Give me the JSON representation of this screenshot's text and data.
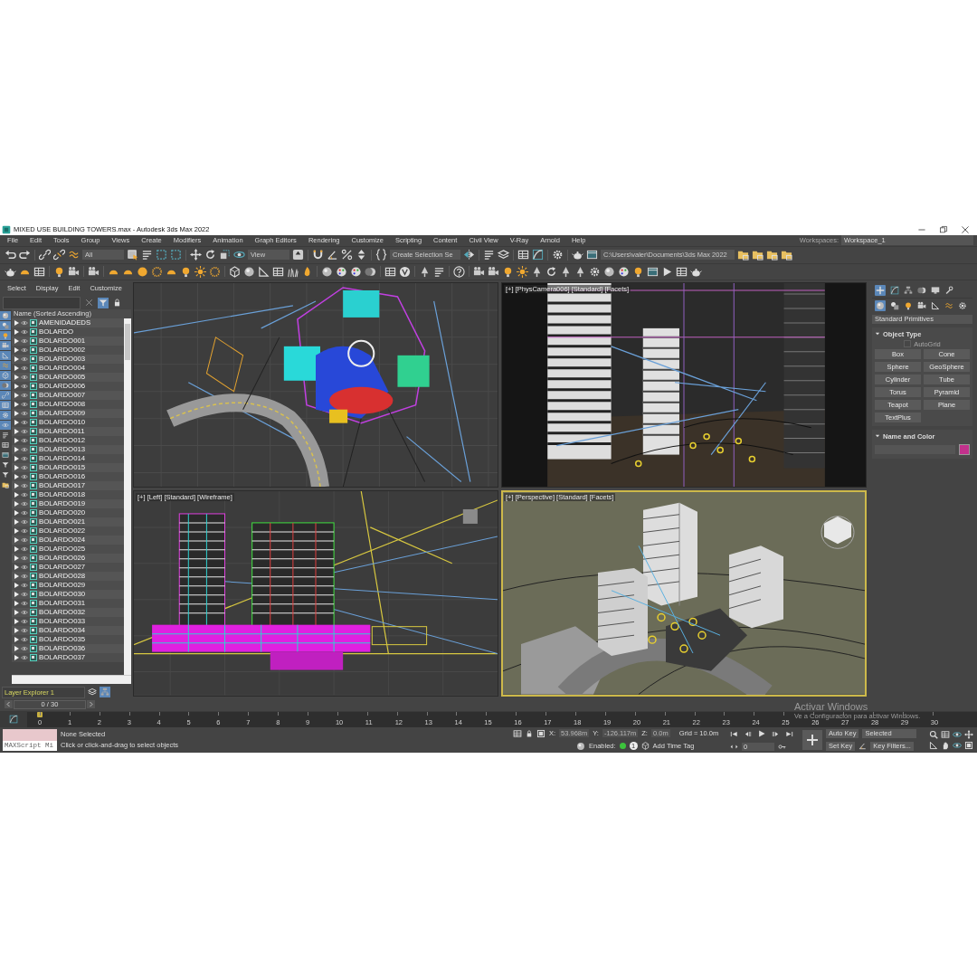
{
  "window": {
    "title": "MIXED USE BUILDING TOWERS.max - Autodesk 3ds Max 2022"
  },
  "menu": [
    "File",
    "Edit",
    "Tools",
    "Group",
    "Views",
    "Create",
    "Modifiers",
    "Animation",
    "Graph Editors",
    "Rendering",
    "Customize",
    "Scripting",
    "Content",
    "Civil View",
    "V-Ray",
    "Arnold",
    "Help"
  ],
  "workspaces": {
    "label": "Workspaces:",
    "value": "Workspace_1"
  },
  "toolbar": {
    "dropdowns": [
      {
        "value": "All"
      },
      {
        "value": "View"
      },
      {
        "value": "Create Selection Se"
      },
      {
        "value": "C:\\Users\\valer\\Documents\\3ds Max 2022"
      }
    ]
  },
  "scene_explorer": {
    "menu": [
      "Select",
      "Display",
      "Edit",
      "Customize"
    ],
    "column": "Name (Sorted Ascending)",
    "filters": [
      {
        "on": true
      },
      {
        "on": true
      },
      {
        "on": true
      },
      {
        "on": true
      },
      {
        "on": true
      },
      {
        "on": true
      },
      {
        "on": true
      },
      {
        "on": true
      },
      {
        "on": true
      },
      {
        "on": true
      },
      {
        "on": true
      },
      {
        "on": true
      },
      {
        "on": false
      },
      {
        "on": false
      },
      {
        "on": false
      },
      {
        "on": false
      },
      {
        "on": false
      },
      {
        "on": false
      }
    ],
    "rows": [
      "AMENIDADEDS",
      "BOLARDO",
      "BOLARDO001",
      "BOLARDO002",
      "BOLARDO003",
      "BOLARDO004",
      "BOLARDO005",
      "BOLARDO006",
      "BOLARDO007",
      "BOLARDO008",
      "BOLARDO009",
      "BOLARDO010",
      "BOLARDO011",
      "BOLARDO012",
      "BOLARDO013",
      "BOLARDO014",
      "BOLARDO015",
      "BOLARDO016",
      "BOLARDO017",
      "BOLARDO018",
      "BOLARDO019",
      "BOLARDO020",
      "BOLARDO021",
      "BOLARDO022",
      "BOLARDO024",
      "BOLARDO025",
      "BOLARDO026",
      "BOLARDO027",
      "BOLARDO028",
      "BOLARDO029",
      "BOLARDO030",
      "BOLARDO031",
      "BOLARDO032",
      "BOLARDO033",
      "BOLARDO034",
      "BOLARDO035",
      "BOLARDO036",
      "BOLARDO037"
    ],
    "layer": "Layer Explorer 1"
  },
  "viewports": [
    {
      "kind": "plan",
      "active": false
    },
    {
      "kind": "camera",
      "label": "[+] [PhysCamera006] [Standard] [Facets]",
      "active": false
    },
    {
      "kind": "elevation",
      "label": "[+] [Left] [Standard] [Wireframe]",
      "active": false
    },
    {
      "kind": "perspective",
      "label": "[+] [Perspective] [Standard] [Facets]",
      "active": true
    }
  ],
  "command_panel": {
    "dropdown": "Standard Primitives",
    "object_type": {
      "title": "Object Type",
      "expanded": true
    },
    "autogrid": {
      "label": "AutoGrid",
      "checked": false,
      "disabled": true
    },
    "buttons": [
      "Box",
      "Cone",
      "Sphere",
      "GeoSphere",
      "Cylinder",
      "Tube",
      "Torus",
      "Pyramid",
      "Teapot",
      "Plane",
      "TextPlus"
    ],
    "name_and_color": {
      "title": "Name and Color",
      "expanded": true,
      "color": "#c2318c"
    }
  },
  "timeline": {
    "position": "0 / 30",
    "ticks": [
      "0",
      "1",
      "2",
      "3",
      "4",
      "5",
      "6",
      "7",
      "8",
      "9",
      "10",
      "11",
      "12",
      "13",
      "14",
      "15",
      "16",
      "17",
      "18",
      "19",
      "20",
      "21",
      "22",
      "23",
      "24",
      "25",
      "26",
      "27",
      "28",
      "29",
      "30"
    ]
  },
  "status": {
    "listener": "MAXScript Mi",
    "selection": "None Selected",
    "prompt": "Click or click-and-drag to select objects",
    "coords": [
      {
        "axis": "X:",
        "value": "53.968m"
      },
      {
        "axis": "Y:",
        "value": "-126.117m"
      },
      {
        "axis": "Z:",
        "value": "0.0m"
      }
    ],
    "grid": "Grid = 10.0m",
    "enabled_label": "Enabled:",
    "enabled": true,
    "time_tag_count": "1",
    "time_tag": "Add Time Tag",
    "frame": "0",
    "auto_key": "Auto Key",
    "key_mode": "Selected",
    "set_key": "Set Key",
    "key_filters": "Key Filters..."
  },
  "os_notice": {
    "title": "Activar Windows",
    "text": "Ve a Configuración para activar Windows."
  }
}
